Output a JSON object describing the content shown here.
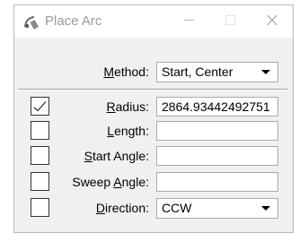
{
  "window": {
    "title": "Place Arc",
    "title_icon": "place-arc-tool-icon"
  },
  "titlebar_buttons": {
    "minimize_icon": "minimize-icon",
    "maximize_icon": "maximize-icon",
    "close_icon": "close-icon"
  },
  "method": {
    "label_pre": "",
    "label_key": "M",
    "label_post": "ethod:",
    "value": "Start, Center"
  },
  "radius": {
    "checked": true,
    "label_pre": "",
    "label_key": "R",
    "label_post": "adius:",
    "value": "2864.93442492751"
  },
  "length": {
    "checked": false,
    "label_pre": "",
    "label_key": "L",
    "label_post": "ength:",
    "value": ""
  },
  "start_angle": {
    "checked": false,
    "label_pre": "",
    "label_key": "S",
    "label_post": "tart Angle:",
    "value": ""
  },
  "sweep_angle": {
    "checked": false,
    "label_pre": "Sweep ",
    "label_key": "A",
    "label_post": "ngle:",
    "value": ""
  },
  "direction": {
    "checked": false,
    "label_pre": "",
    "label_key": "D",
    "label_post": "irection:",
    "value": "CCW"
  }
}
